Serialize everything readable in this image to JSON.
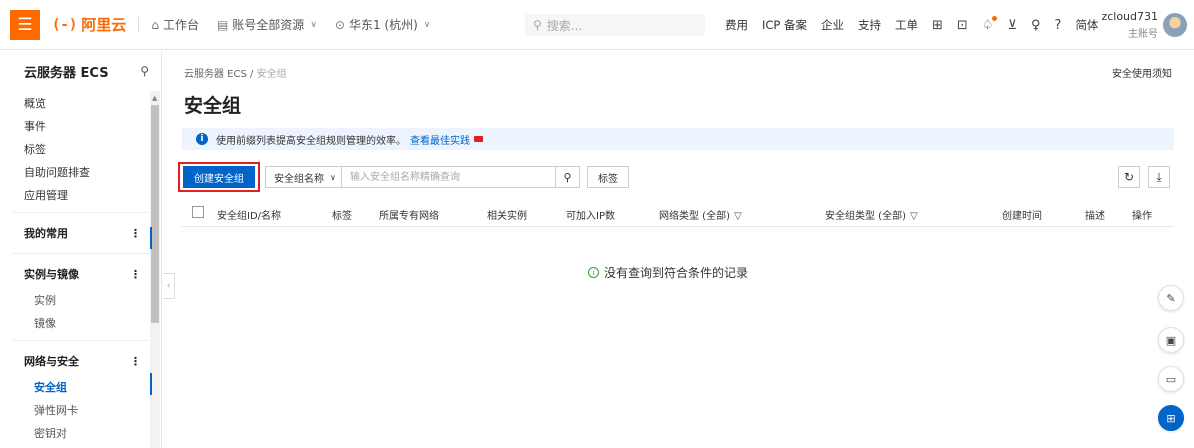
{
  "topbar": {
    "logo_text": "阿里云",
    "workbench_label": "工作台",
    "resource_label": "账号全部资源",
    "region_label": "华东1 (杭州)",
    "search_placeholder": "搜索...",
    "links": [
      "费用",
      "ICP 备案",
      "企业",
      "支持",
      "工单"
    ],
    "language_label": "简体",
    "user_name": "zcloud731",
    "user_role": "主账号"
  },
  "sidebar": {
    "title": "云服务器 ECS",
    "top_items": [
      "概览",
      "事件",
      "标签",
      "自助问题排查",
      "应用管理"
    ],
    "group_common": "我的常用",
    "group_instances": "实例与镜像",
    "instance_items": [
      "实例",
      "镜像"
    ],
    "group_network": "网络与安全",
    "network_items": [
      "安全组",
      "弹性网卡",
      "密钥对"
    ]
  },
  "main": {
    "breadcrumb_root": "云服务器 ECS",
    "breadcrumb_sep": "/",
    "breadcrumb_current": "安全组",
    "notice_link": "安全使用须知",
    "page_title": "安全组",
    "info_text": "使用前缀列表提高安全组规则管理的效率。",
    "info_link": "查看最佳实践",
    "create_button": "创建安全组",
    "filter_select": "安全组名称",
    "filter_placeholder": "输入安全组名称精确查询",
    "tag_button": "标签",
    "columns": [
      "安全组ID/名称",
      "标签",
      "所属专有网络",
      "相关实例",
      "可加入IP数",
      "网络类型 (全部)",
      "安全组类型 (全部)",
      "创建时间",
      "描述",
      "操作"
    ],
    "empty_text": "没有查询到符合条件的记录"
  },
  "colors": {
    "brand_orange": "#ff6a00",
    "primary_blue": "#0064c8",
    "highlight_red": "#e02020"
  }
}
